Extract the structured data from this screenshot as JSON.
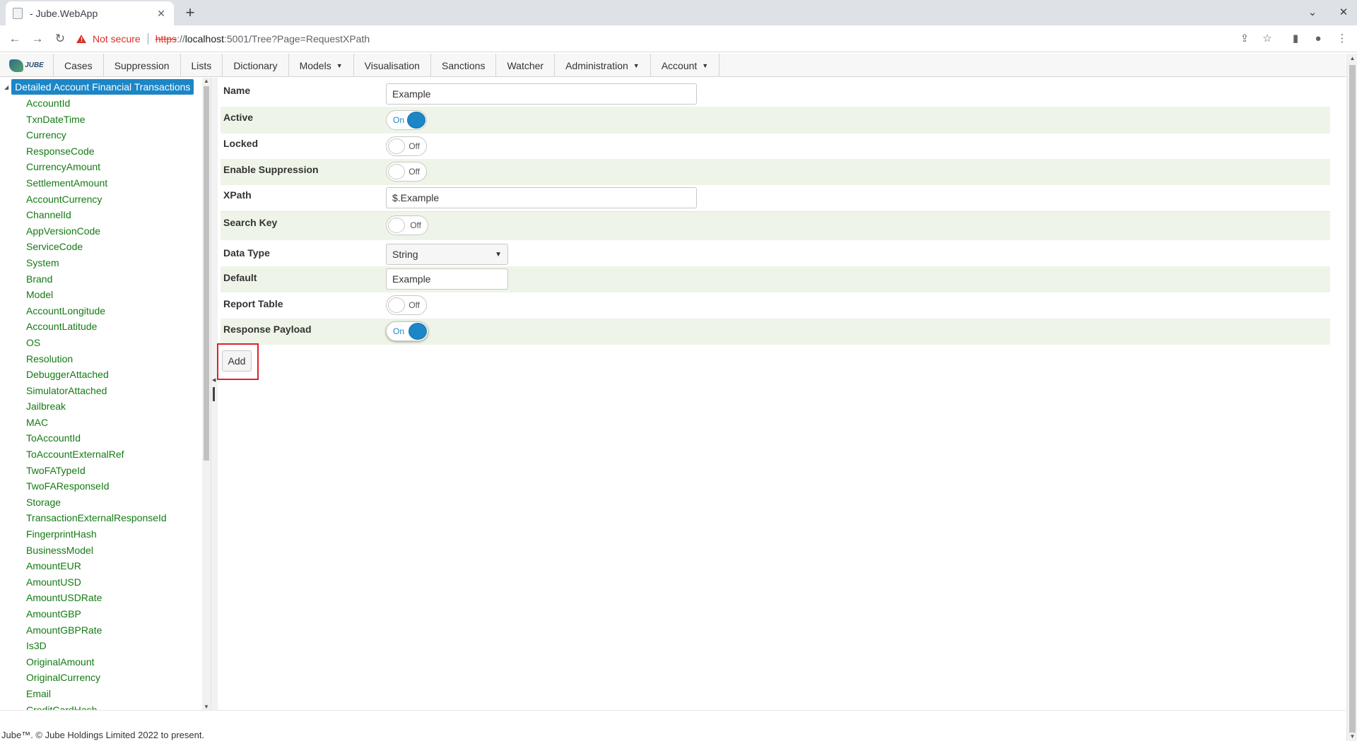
{
  "browser": {
    "tab_title": "- Jube.WebApp",
    "not_secure": "Not secure",
    "url_scheme": "https",
    "url_sep": "://",
    "url_host": "localhost",
    "url_path": ":5001/Tree?Page=RequestXPath"
  },
  "app_nav": {
    "logo_text": "JUBE",
    "items": [
      "Cases",
      "Suppression",
      "Lists",
      "Dictionary",
      "Models",
      "Visualisation",
      "Sanctions",
      "Watcher",
      "Administration",
      "Account"
    ]
  },
  "tree": {
    "root": "Detailed Account Financial Transactions",
    "items": [
      "AccountId",
      "TxnDateTime",
      "Currency",
      "ResponseCode",
      "CurrencyAmount",
      "SettlementAmount",
      "AccountCurrency",
      "ChannelId",
      "AppVersionCode",
      "ServiceCode",
      "System",
      "Brand",
      "Model",
      "AccountLongitude",
      "AccountLatitude",
      "OS",
      "Resolution",
      "DebuggerAttached",
      "SimulatorAttached",
      "Jailbreak",
      "MAC",
      "ToAccountId",
      "ToAccountExternalRef",
      "TwoFATypeId",
      "TwoFAResponseId",
      "Storage",
      "TransactionExternalResponseId",
      "FingerprintHash",
      "BusinessModel",
      "AmountEUR",
      "AmountUSD",
      "AmountUSDRate",
      "AmountGBP",
      "AmountGBPRate",
      "Is3D",
      "OriginalAmount",
      "OriginalCurrency",
      "Email",
      "CreditCardHash"
    ]
  },
  "form": {
    "name": {
      "label": "Name",
      "value": "Example"
    },
    "active": {
      "label": "Active",
      "state": "On"
    },
    "locked": {
      "label": "Locked",
      "state": "Off"
    },
    "enable_suppression": {
      "label": "Enable Suppression",
      "state": "Off"
    },
    "xpath": {
      "label": "XPath",
      "value": "$.Example"
    },
    "search_key": {
      "label": "Search Key",
      "state": "Off"
    },
    "data_type": {
      "label": "Data Type",
      "value": "String"
    },
    "default": {
      "label": "Default",
      "value": "Example"
    },
    "report_table": {
      "label": "Report Table",
      "state": "Off"
    },
    "response_payload": {
      "label": "Response Payload",
      "state": "On"
    },
    "add_label": "Add"
  },
  "footer": "Jube™. © Jube Holdings Limited 2022 to present.",
  "colors": {
    "accent": "#1c86c6",
    "tree_text": "#137a13",
    "alt_row": "#eef5e8",
    "highlight": "#e0202a"
  }
}
